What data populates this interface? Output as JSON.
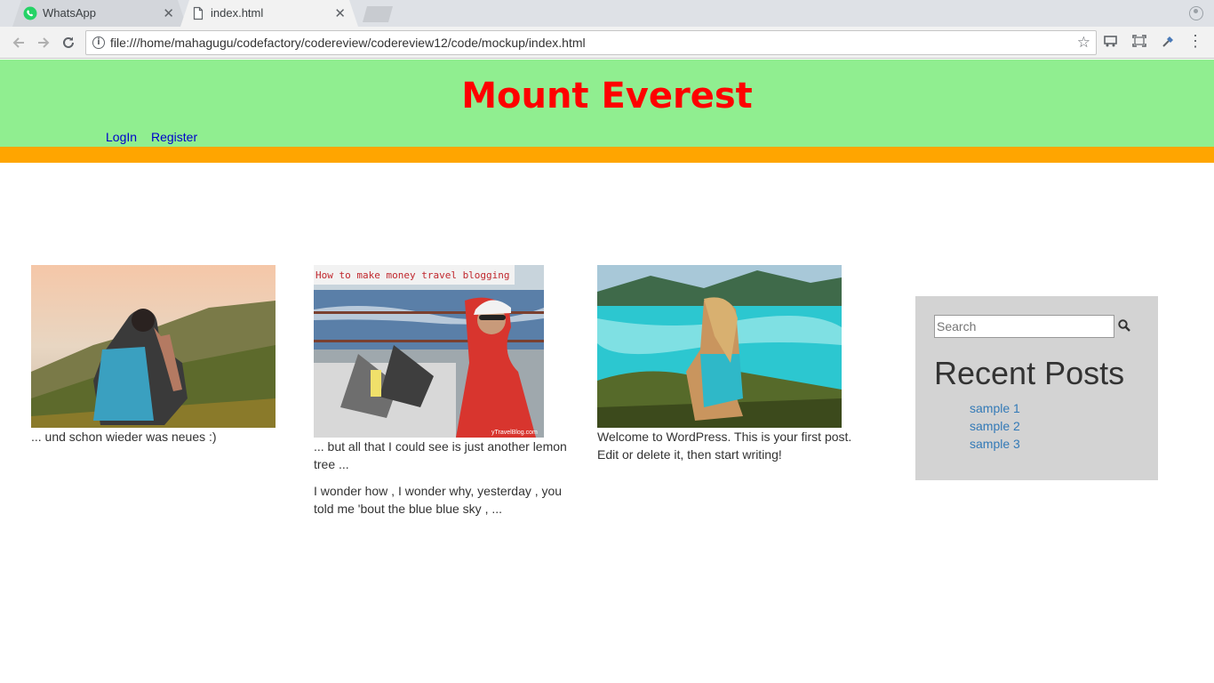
{
  "browser": {
    "tabs": [
      {
        "label": "WhatsApp",
        "active": false
      },
      {
        "label": "index.html",
        "active": true
      }
    ],
    "url": "file:///home/mahagugu/codefactory/codereview/codereview12/code/mockup/index.html"
  },
  "site": {
    "title": "Mount Everest",
    "nav": [
      {
        "label": "LogIn"
      },
      {
        "label": "Register"
      }
    ],
    "colors": {
      "header_bg": "#90ee90",
      "title": "#ff0000",
      "bar": "#ffa500",
      "sidebar_bg": "#d3d3d3",
      "link": "#337ab7"
    }
  },
  "posts": [
    {
      "image": "hiker-woman-mountains-photo",
      "paragraphs": [
        "... und schon wieder was neues :)"
      ]
    },
    {
      "image": "travel-blogging-cruise-photo",
      "image_caption": "How to make money travel blogging",
      "image_watermark": "yTravelBlog.com",
      "paragraphs": [
        "... but all that I could see is just another lemon tree ...",
        "I wonder how , I wonder why, yesterday , you told me 'bout the blue blue sky , ..."
      ]
    },
    {
      "image": "woman-turquoise-beach-photo",
      "paragraphs": [
        "Welcome to WordPress. This is your first post. Edit or delete it, then start writing!"
      ]
    }
  ],
  "sidebar": {
    "search_placeholder": "Search",
    "recent_title": "Recent Posts",
    "recent_posts": [
      "sample 1",
      "sample 2",
      "sample 3"
    ]
  }
}
